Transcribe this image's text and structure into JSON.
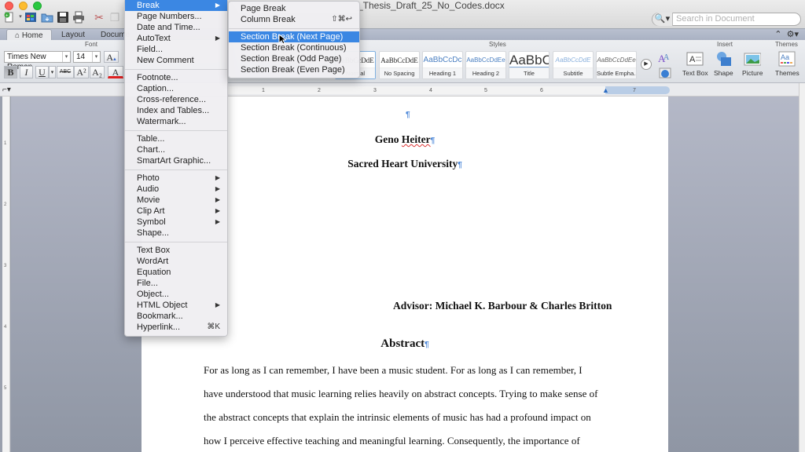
{
  "window": {
    "title": "_Thesis_Draft_25_No_Codes.docx",
    "search_placeholder": "Search in Document"
  },
  "tabs": [
    {
      "label": "Home",
      "active": true
    },
    {
      "label": "Layout",
      "active": false
    },
    {
      "label": "Docume",
      "active": false
    }
  ],
  "ribbon": {
    "font_group_label": "Font",
    "styles_group_label": "Styles",
    "insert_group_label": "Insert",
    "themes_group_label": "Themes",
    "font_name": "Times New Roman",
    "font_size": "14",
    "format_buttons": [
      "B",
      "I",
      "U",
      "ABC",
      "A²",
      "A₂",
      "A"
    ],
    "styles": [
      {
        "sample": "AaBbCcDdE",
        "name": "Normal"
      },
      {
        "sample": "AaBbCcDdE",
        "name": "No Spacing"
      },
      {
        "sample": "AaBbCcDc",
        "name": "Heading 1"
      },
      {
        "sample": "AaBbCcDdEe",
        "name": "Heading 2"
      },
      {
        "sample": "AaBbC",
        "name": "Title"
      },
      {
        "sample": "AaBbCcDdE",
        "name": "Subtitle"
      },
      {
        "sample": "AaBbCcDdEe",
        "name": "Subtle Empha..."
      }
    ],
    "insert_buttons": [
      "Text Box",
      "Shape",
      "Picture"
    ],
    "themes_button": "Themes"
  },
  "ruler": {
    "h_ticks": [
      "1",
      "2",
      "3",
      "4",
      "5",
      "6",
      "7"
    ],
    "v_ticks": [
      "1",
      "2",
      "3",
      "4",
      "5"
    ]
  },
  "insert_menu": {
    "groups": [
      [
        {
          "label": "Break",
          "submenu": true,
          "highlighted": true
        },
        {
          "label": "Page Numbers..."
        },
        {
          "label": "Date and Time..."
        },
        {
          "label": "AutoText",
          "submenu": true
        },
        {
          "label": "Field..."
        },
        {
          "label": "New Comment"
        }
      ],
      [
        {
          "label": "Footnote..."
        },
        {
          "label": "Caption..."
        },
        {
          "label": "Cross-reference..."
        },
        {
          "label": "Index and Tables..."
        },
        {
          "label": "Watermark..."
        }
      ],
      [
        {
          "label": "Table..."
        },
        {
          "label": "Chart..."
        },
        {
          "label": "SmartArt Graphic..."
        }
      ],
      [
        {
          "label": "Photo",
          "submenu": true
        },
        {
          "label": "Audio",
          "submenu": true
        },
        {
          "label": "Movie",
          "submenu": true
        },
        {
          "label": "Clip Art",
          "submenu": true
        },
        {
          "label": "Symbol",
          "submenu": true
        },
        {
          "label": "Shape..."
        }
      ],
      [
        {
          "label": "Text Box"
        },
        {
          "label": "WordArt"
        },
        {
          "label": "Equation"
        },
        {
          "label": "File..."
        },
        {
          "label": "Object..."
        },
        {
          "label": "HTML Object",
          "submenu": true
        },
        {
          "label": "Bookmark..."
        },
        {
          "label": "Hyperlink...",
          "shortcut": "⌘K"
        }
      ]
    ]
  },
  "break_submenu": {
    "groups": [
      [
        {
          "label": "Page Break"
        },
        {
          "label": "Column Break",
          "shortcut": "⇧⌘↩"
        }
      ],
      [
        {
          "label": "Section Break (Next Page)",
          "highlighted": true
        },
        {
          "label": "Section Break (Continuous)"
        },
        {
          "label": "Section Break (Odd Page)"
        },
        {
          "label": "Section Break (Even Page)"
        }
      ]
    ]
  },
  "document": {
    "pilcrow": "¶",
    "author": "Geno Heiter",
    "university": "Sacred Heart University",
    "advisor": "Advisor: Michael K. Barbour & Charles Britton",
    "abstract_heading": "Abstract",
    "body_lines": [
      "For as long as I can remember, I have been a music student. For as long as I can remember, I",
      "have understood that music learning relies heavily on abstract concepts. Trying to make sense of",
      "the abstract concepts that explain the intrinsic elements of music has had a profound impact on",
      "how I perceive effective teaching and meaningful learning. Consequently, the importance of"
    ]
  },
  "colors": {
    "menu_highlight": "#3b87e3",
    "pilcrow": "#4a86d8",
    "font_color_bar": "#e02020"
  }
}
